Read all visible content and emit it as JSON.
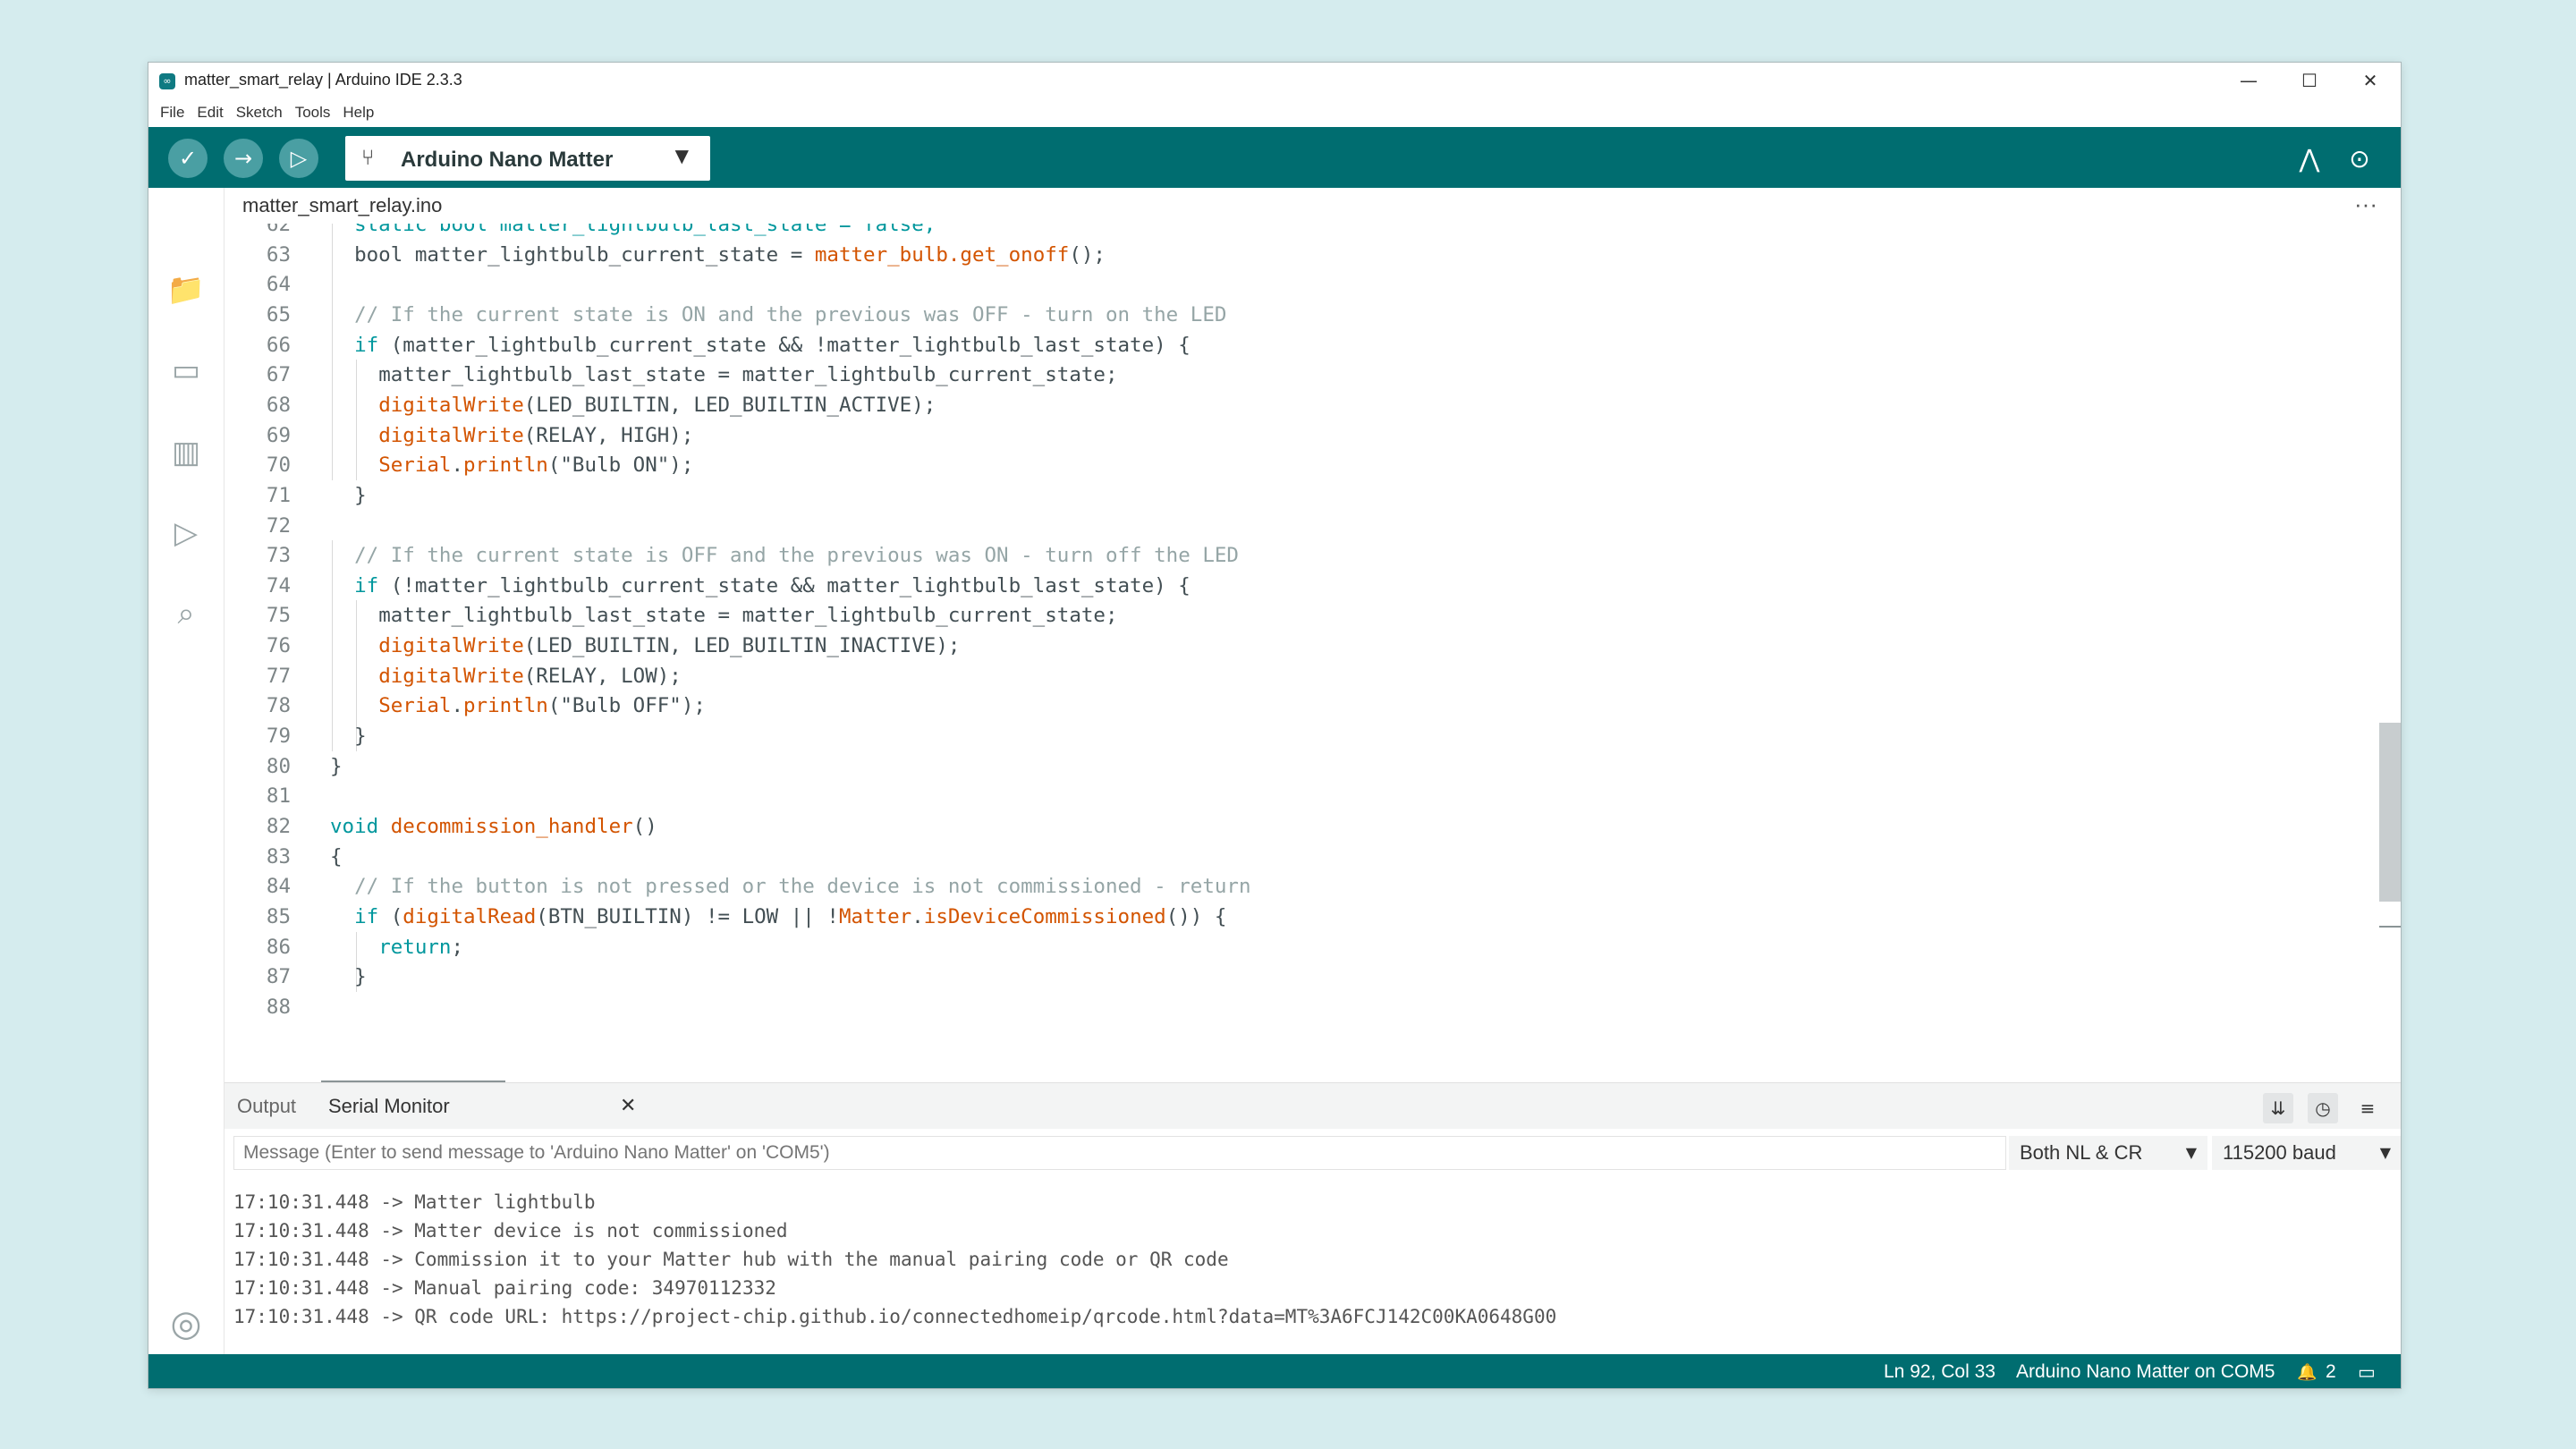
{
  "window": {
    "title": "matter_smart_relay | Arduino IDE 2.3.3",
    "app_icon": "arduino-logo-icon",
    "controls": [
      "—",
      "☐",
      "✕"
    ]
  },
  "menu": [
    "File",
    "Edit",
    "Sketch",
    "Tools",
    "Help"
  ],
  "toolbar": {
    "verify_icon": "✓",
    "upload_icon": "→",
    "debug_icon": "▷",
    "board_icon": "⑂",
    "board_name": "Arduino Nano Matter",
    "board_caret": "▼",
    "plotter_icon": "⋀",
    "monitor_icon": "⊙"
  },
  "sidebar": {
    "icons": [
      "📁",
      "▭",
      "▥",
      "▷",
      "⌕"
    ],
    "account_icon": "◎"
  },
  "editor": {
    "file_tab": "matter_smart_relay.ino",
    "more": "···",
    "lines": [
      {
        "n": "62",
        "indent": 1,
        "parts": [
          {
            "t": "static bool matter_lightbulb_last_state = false;",
            "c": "kw"
          }
        ]
      },
      {
        "n": "63",
        "indent": 1,
        "parts": [
          {
            "t": "bool matter_lightbulb_current_state = ",
            "c": ""
          },
          {
            "t": "matter_bulb.get_onoff",
            "c": "fn"
          },
          {
            "t": "();",
            "c": ""
          }
        ]
      },
      {
        "n": "64",
        "indent": 0,
        "parts": []
      },
      {
        "n": "65",
        "indent": 1,
        "parts": [
          {
            "t": "// If the current state is ON and the previous was OFF - turn on the LED",
            "c": "cm"
          }
        ]
      },
      {
        "n": "66",
        "indent": 1,
        "parts": [
          {
            "t": "if",
            "c": "kw"
          },
          {
            "t": " (matter_lightbulb_current_state && !matter_lightbulb_last_state) {",
            "c": ""
          }
        ]
      },
      {
        "n": "67",
        "indent": 2,
        "parts": [
          {
            "t": "matter_lightbulb_last_state = matter_lightbulb_current_state;",
            "c": ""
          }
        ]
      },
      {
        "n": "68",
        "indent": 2,
        "parts": [
          {
            "t": "digitalWrite",
            "c": "fn"
          },
          {
            "t": "(LED_BUILTIN, LED_BUILTIN_ACTIVE);",
            "c": ""
          }
        ]
      },
      {
        "n": "69",
        "indent": 2,
        "parts": [
          {
            "t": "digitalWrite",
            "c": "fn"
          },
          {
            "t": "(RELAY, HIGH);",
            "c": ""
          }
        ]
      },
      {
        "n": "70",
        "indent": 2,
        "parts": [
          {
            "t": "Serial",
            "c": "fn"
          },
          {
            "t": ".",
            "c": ""
          },
          {
            "t": "println",
            "c": "fn"
          },
          {
            "t": "(\"Bulb ON\");",
            "c": ""
          }
        ]
      },
      {
        "n": "71",
        "indent": 1,
        "parts": [
          {
            "t": "}",
            "c": ""
          }
        ]
      },
      {
        "n": "72",
        "indent": 0,
        "parts": []
      },
      {
        "n": "73",
        "indent": 1,
        "parts": [
          {
            "t": "// If the current state is OFF and the previous was ON - turn off the LED",
            "c": "cm"
          }
        ]
      },
      {
        "n": "74",
        "indent": 1,
        "parts": [
          {
            "t": "if",
            "c": "kw"
          },
          {
            "t": " (!matter_lightbulb_current_state && matter_lightbulb_last_state) {",
            "c": ""
          }
        ]
      },
      {
        "n": "75",
        "indent": 2,
        "parts": [
          {
            "t": "matter_lightbulb_last_state = matter_lightbulb_current_state;",
            "c": ""
          }
        ]
      },
      {
        "n": "76",
        "indent": 2,
        "parts": [
          {
            "t": "digitalWrite",
            "c": "fn"
          },
          {
            "t": "(LED_BUILTIN, LED_BUILTIN_INACTIVE);",
            "c": ""
          }
        ]
      },
      {
        "n": "77",
        "indent": 2,
        "parts": [
          {
            "t": "digitalWrite",
            "c": "fn"
          },
          {
            "t": "(RELAY, LOW);",
            "c": ""
          }
        ]
      },
      {
        "n": "78",
        "indent": 2,
        "parts": [
          {
            "t": "Serial",
            "c": "fn"
          },
          {
            "t": ".",
            "c": ""
          },
          {
            "t": "println",
            "c": "fn"
          },
          {
            "t": "(\"Bulb OFF\");",
            "c": ""
          }
        ]
      },
      {
        "n": "79",
        "indent": 1,
        "parts": [
          {
            "t": "}",
            "c": ""
          }
        ]
      },
      {
        "n": "80",
        "indent": 0,
        "parts": [
          {
            "t": "}",
            "c": ""
          }
        ]
      },
      {
        "n": "81",
        "indent": 0,
        "parts": []
      },
      {
        "n": "82",
        "indent": 0,
        "parts": [
          {
            "t": "void",
            "c": "kw"
          },
          {
            "t": " ",
            "c": ""
          },
          {
            "t": "decommission_handler",
            "c": "fn"
          },
          {
            "t": "()",
            "c": ""
          }
        ]
      },
      {
        "n": "83",
        "indent": 0,
        "parts": [
          {
            "t": "{",
            "c": ""
          }
        ]
      },
      {
        "n": "84",
        "indent": 1,
        "parts": [
          {
            "t": "// If the button is not pressed or the device is not commissioned - return",
            "c": "cm"
          }
        ]
      },
      {
        "n": "85",
        "indent": 1,
        "parts": [
          {
            "t": "if",
            "c": "kw"
          },
          {
            "t": " (",
            "c": ""
          },
          {
            "t": "digitalRead",
            "c": "fn"
          },
          {
            "t": "(BTN_BUILTIN) != LOW || !",
            "c": ""
          },
          {
            "t": "Matter",
            "c": "fn"
          },
          {
            "t": ".",
            "c": ""
          },
          {
            "t": "isDeviceCommissioned",
            "c": "fn"
          },
          {
            "t": "()) {",
            "c": ""
          }
        ]
      },
      {
        "n": "86",
        "indent": 2,
        "parts": [
          {
            "t": "return",
            "c": "kw"
          },
          {
            "t": ";",
            "c": ""
          }
        ]
      },
      {
        "n": "87",
        "indent": 1,
        "parts": [
          {
            "t": "}",
            "c": ""
          }
        ]
      },
      {
        "n": "88",
        "indent": 0,
        "parts": []
      }
    ]
  },
  "panel": {
    "tabs": {
      "output": "Output",
      "serial": "Serial Monitor",
      "close": "✕"
    },
    "icons": {
      "autoscroll": "⇊",
      "timestamp": "◷",
      "clear": "≡"
    },
    "message_placeholder": "Message (Enter to send message to 'Arduino Nano Matter' on 'COM5')",
    "line_ending": "Both NL & CR",
    "baud": "115200 baud",
    "caret": "▼",
    "serial_lines": [
      "17:10:31.448 -> Matter lightbulb",
      "17:10:31.448 -> Matter device is not commissioned",
      "17:10:31.448 -> Commission it to your Matter hub with the manual pairing code or QR code",
      "17:10:31.448 -> Manual pairing code: 34970112332",
      "17:10:31.448 -> QR code URL: https://project-chip.github.io/connectedhomeip/qrcode.html?data=MT%3A6FCJ142C00KA0648G00"
    ]
  },
  "status": {
    "position": "Ln 92, Col 33",
    "board": "Arduino Nano Matter on COM5",
    "notifications_icon": "🔔",
    "notifications": "2",
    "layout_icon": "▭"
  },
  "colors": {
    "accent": "#006d70",
    "keyword": "#00979d",
    "function": "#d35400",
    "comment": "#95a5a6"
  }
}
